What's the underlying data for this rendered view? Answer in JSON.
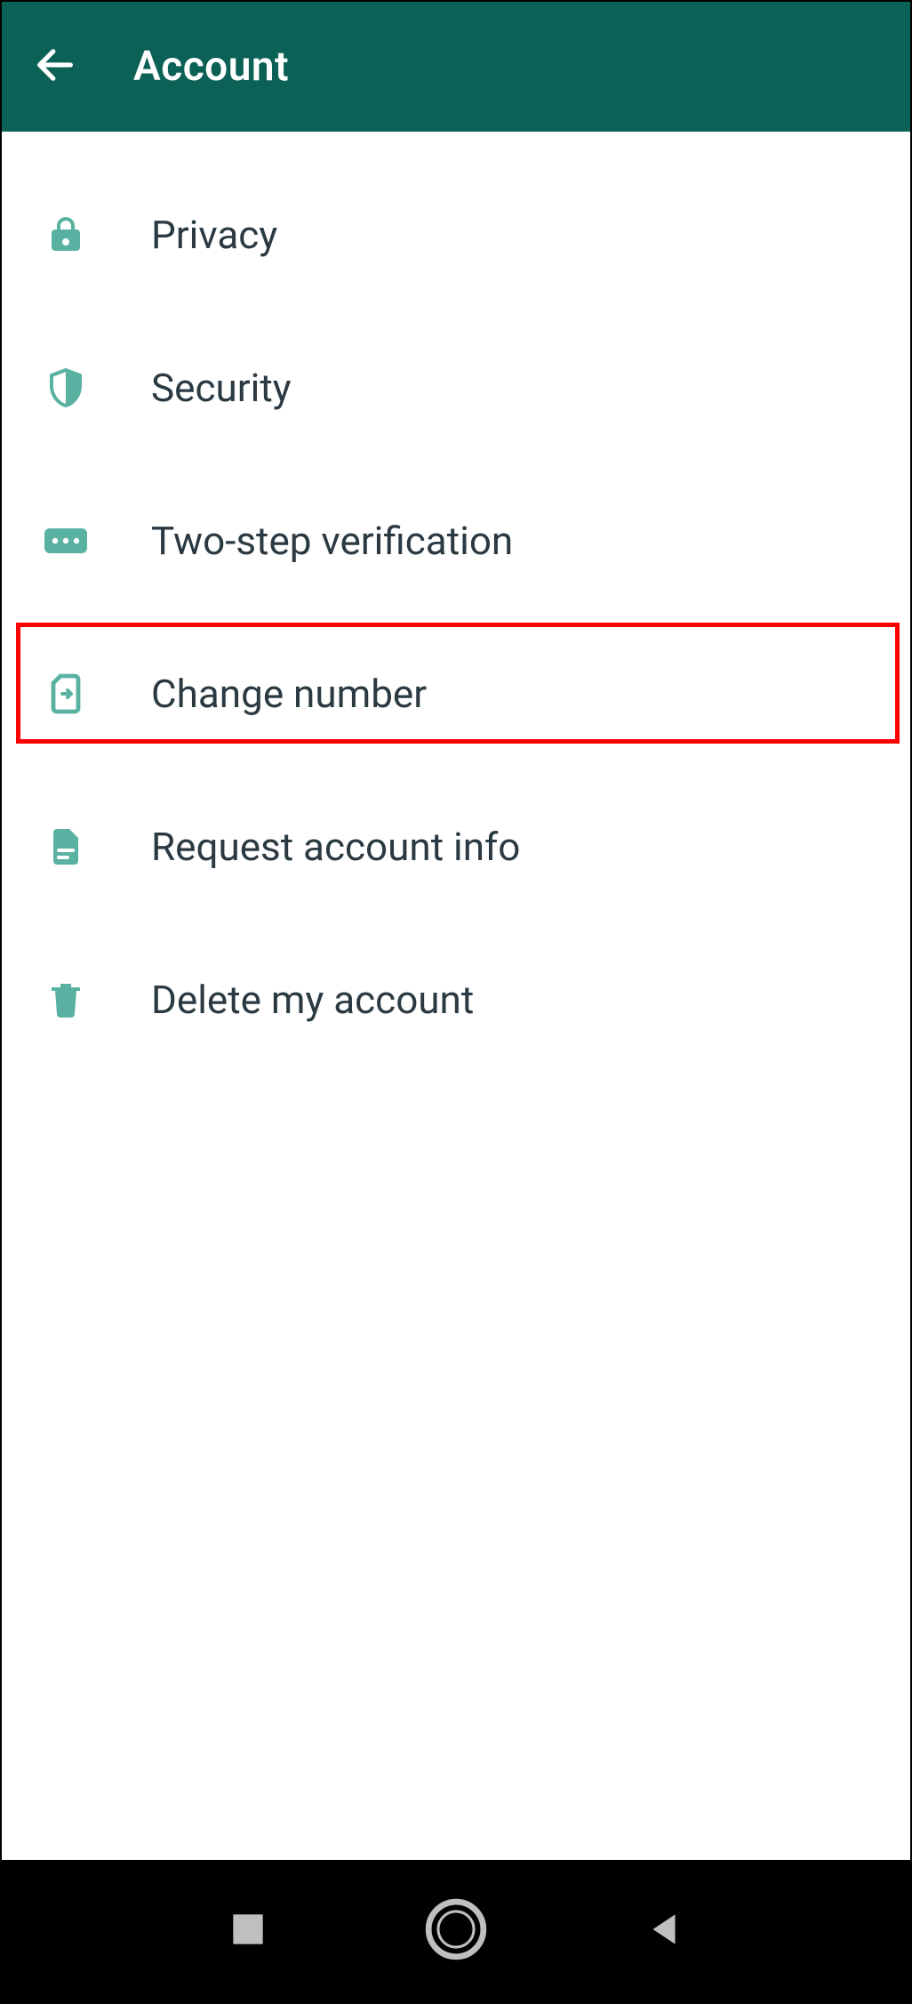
{
  "header": {
    "title": "Account"
  },
  "items": [
    {
      "label": "Privacy"
    },
    {
      "label": "Security"
    },
    {
      "label": "Two-step verification"
    },
    {
      "label": "Change number"
    },
    {
      "label": "Request account info"
    },
    {
      "label": "Delete my account"
    }
  ],
  "highlight_index": 3,
  "colors": {
    "appbar_bg": "#0b6156",
    "icon": "#59b2a1",
    "text": "#2b3a42",
    "highlight": "#ff0000"
  }
}
